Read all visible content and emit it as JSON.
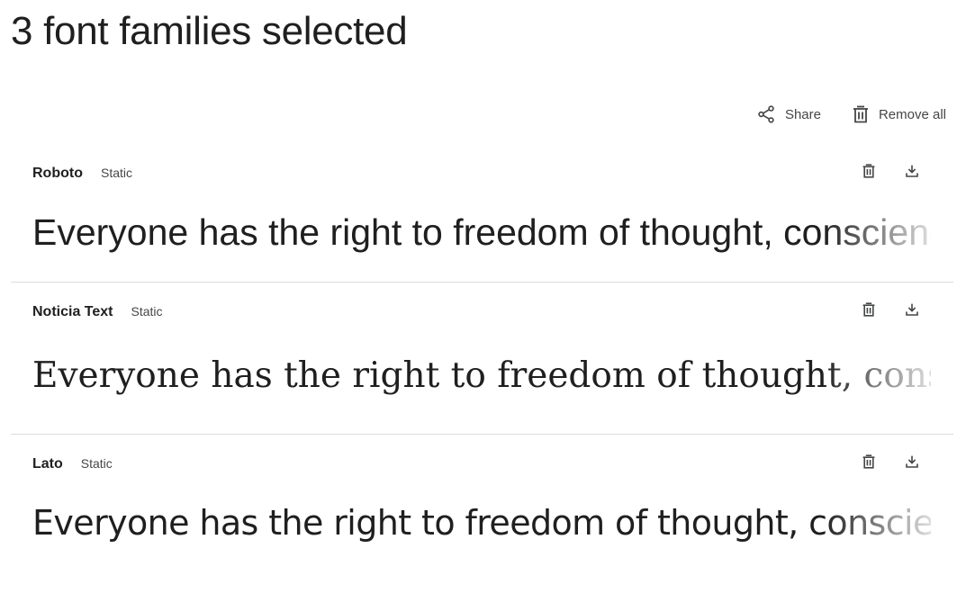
{
  "header": {
    "title": "3 font families selected"
  },
  "toolbar": {
    "share_label": "Share",
    "share_icon": "share-icon",
    "remove_all_label": "Remove all",
    "remove_all_icon": "trash-icon"
  },
  "fonts": [
    {
      "name": "Roboto",
      "tag": "Static",
      "sample": "Everyone has the right to freedom of thought, conscience"
    },
    {
      "name": "Noticia Text",
      "tag": "Static",
      "sample": "Everyone has the right to freedom of thought, conscie"
    },
    {
      "name": "Lato",
      "tag": "Static",
      "sample": "Everyone has the right to freedom of thought, conscience"
    }
  ],
  "colors": {
    "text": "#1f1f1f",
    "secondary": "#444746",
    "divider": "#dadce0"
  }
}
